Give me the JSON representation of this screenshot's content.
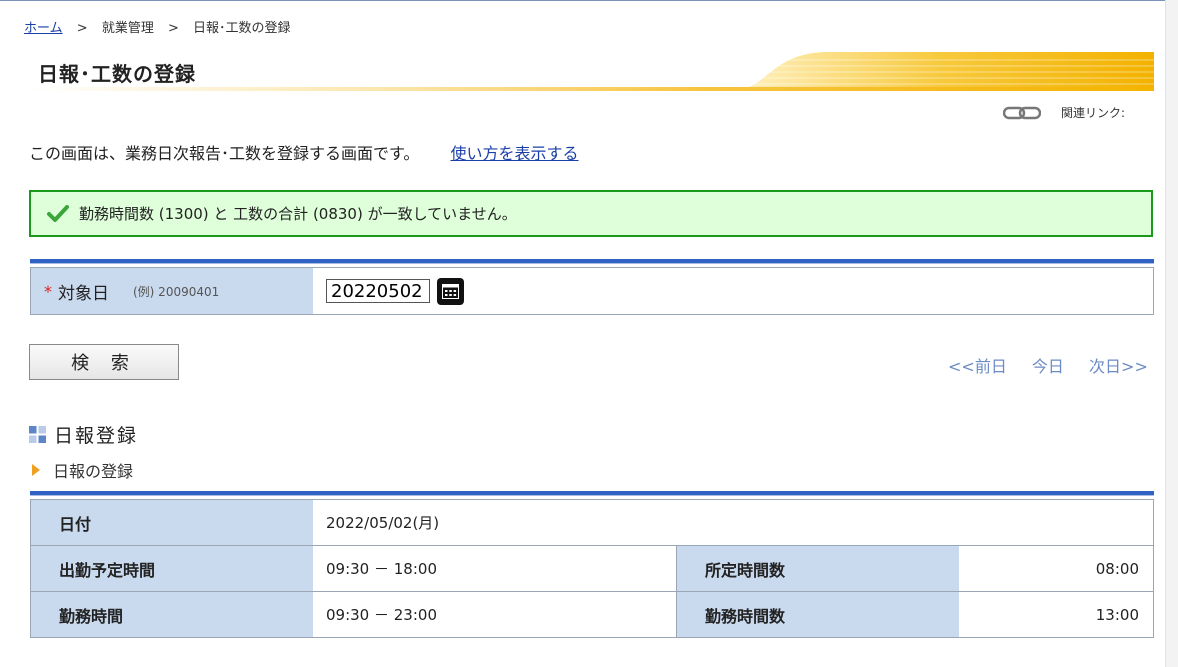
{
  "breadcrumb": {
    "home": "ホーム",
    "sep1": ">",
    "level2": "就業管理",
    "sep2": ">",
    "current": "日報･工数の登録"
  },
  "page": {
    "title": "日報･工数の登録",
    "related_links_label": "関連リンク:",
    "description": "この画面は、業務日次報告･工数を登録する画面です。",
    "help_link": "使い方を表示する"
  },
  "message": {
    "text": "勤務時間数 (1300) と 工数の合計 (0830) が一致していません。"
  },
  "search_form": {
    "required_mark": "*",
    "label": "対象日",
    "example": "(例) 20090401",
    "value": "20220502",
    "search_button": "検 索"
  },
  "day_nav": {
    "prev": "<<前日",
    "today": "今日",
    "next": "次日>>"
  },
  "section": {
    "title": "日報登録",
    "subtitle": "日報の登録"
  },
  "info": {
    "date_label": "日付",
    "date_value": "2022/05/02(月)",
    "scheduled_label": "出勤予定時間",
    "scheduled_value": "09:30 － 18:00",
    "prescribed_hours_label": "所定時間数",
    "prescribed_hours_value": "08:00",
    "work_time_label": "勤務時間",
    "work_time_value": "09:30 － 23:00",
    "work_hours_label": "勤務時間数",
    "work_hours_value": "13:00"
  },
  "colors": {
    "accent_blue": "#2f63c5",
    "header_bg": "#c9d9ee",
    "success_border": "#1a9a1a",
    "success_bg": "#dfffda",
    "title_gold": "#f4b400"
  }
}
